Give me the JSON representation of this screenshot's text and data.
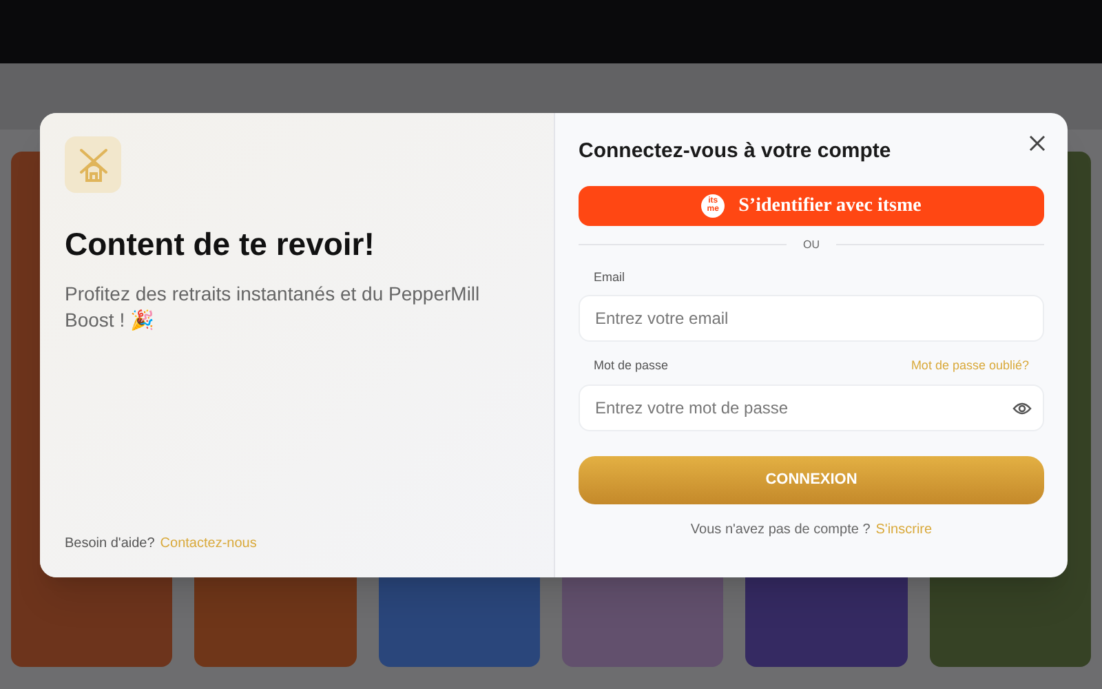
{
  "welcome": {
    "title": "Content de te revoir!",
    "subtitle": "Profitez des retraits instantanés et du PepperMill Boost ! 🎉",
    "help_text": "Besoin d'aide?",
    "help_link": "Contactez-nous"
  },
  "login": {
    "title": "Connectez-vous à votre compte",
    "itsme_button": "S’identifier avec itsme",
    "itsme_logo": "its me",
    "divider": "OU",
    "email": {
      "label": "Email",
      "placeholder": "Entrez votre email"
    },
    "password": {
      "label": "Mot de passe",
      "placeholder": "Entrez votre mot de passe",
      "forgot_link": "Mot de passe oublié?"
    },
    "submit": "CONNEXION",
    "signup_text": "Vous n'avez pas de compte ?",
    "signup_link": "S'inscrire"
  }
}
